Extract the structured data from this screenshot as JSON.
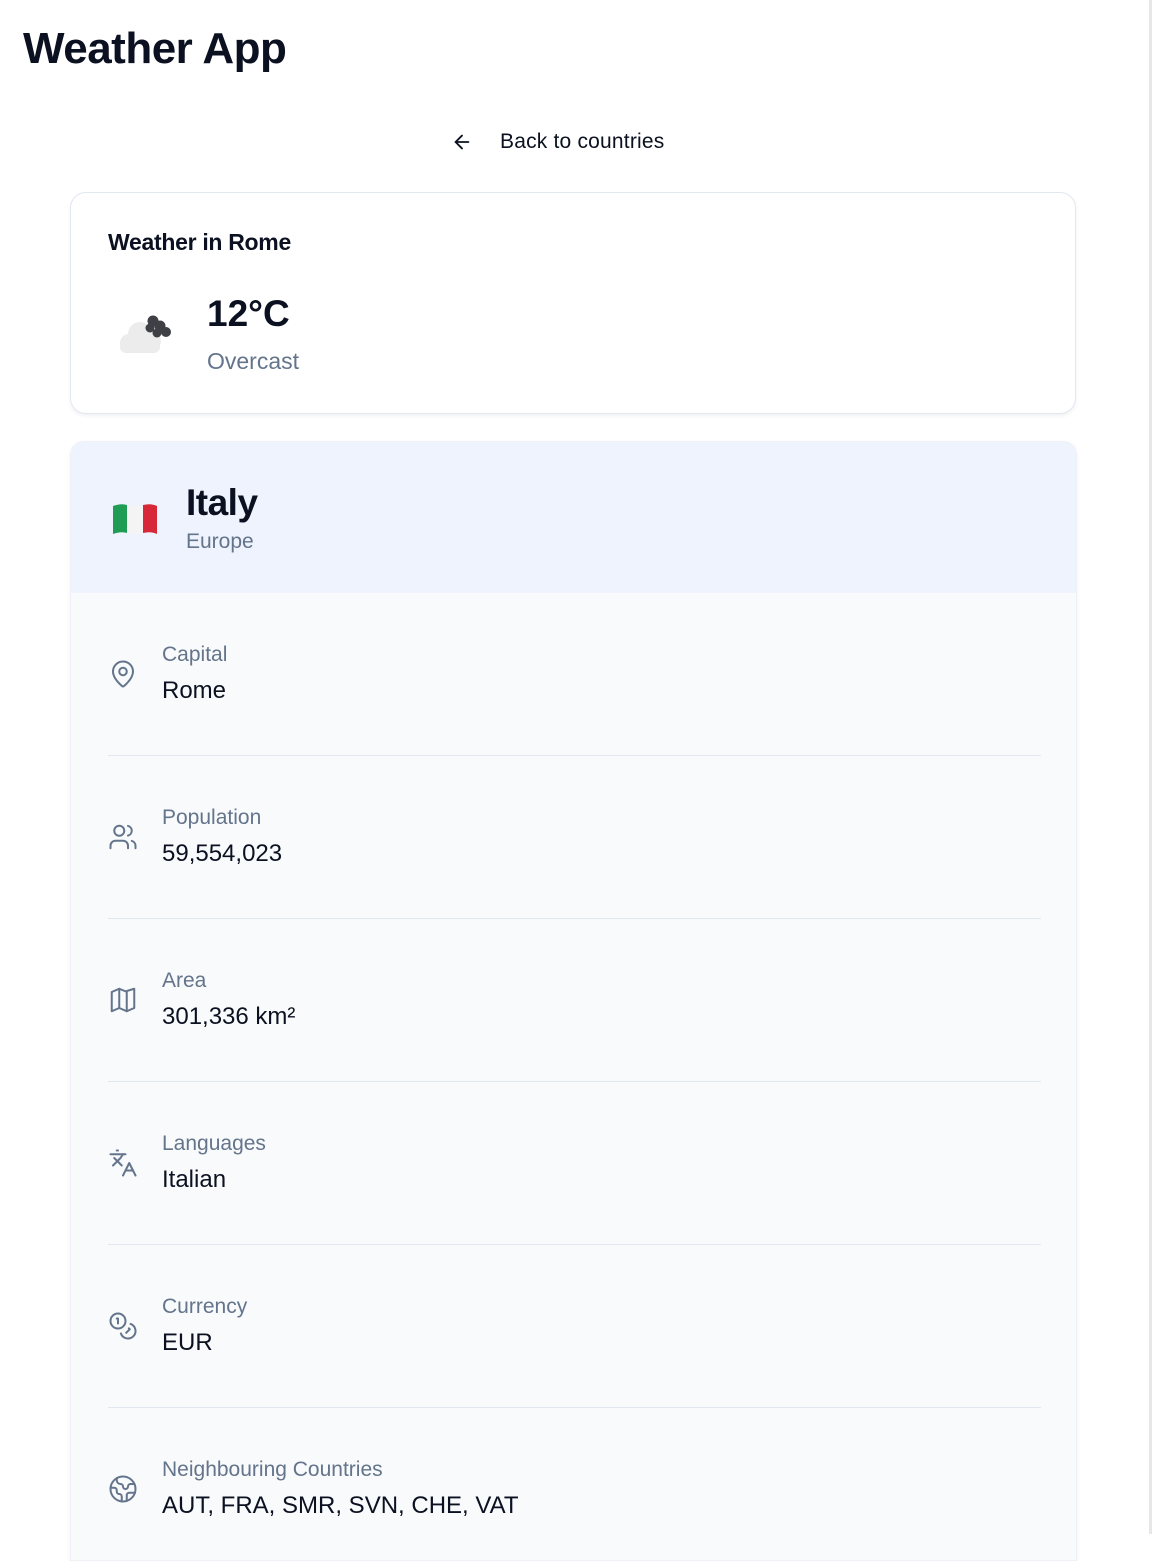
{
  "app": {
    "title": "Weather App"
  },
  "nav": {
    "back_label": "Back to countries",
    "back_icon": "arrow-left-icon"
  },
  "weather": {
    "title": "Weather in Rome",
    "temperature": "12°C",
    "description": "Overcast",
    "icon": "cloud-icon"
  },
  "country": {
    "name": "Italy",
    "region": "Europe",
    "flag_icon": "italy-flag-icon"
  },
  "details": [
    {
      "label": "Capital",
      "value": "Rome",
      "icon": "map-pin-icon"
    },
    {
      "label": "Population",
      "value": "59,554,023",
      "icon": "users-icon"
    },
    {
      "label": "Area",
      "value": "301,336 km²",
      "icon": "map-icon"
    },
    {
      "label": "Languages",
      "value": "Italian",
      "icon": "languages-icon"
    },
    {
      "label": "Currency",
      "value": "EUR",
      "icon": "coins-icon"
    },
    {
      "label": "Neighbouring Countries",
      "value": "AUT, FRA, SMR, SVN, CHE, VAT",
      "icon": "globe-icon"
    }
  ],
  "colors": {
    "text_primary": "#0b1120",
    "text_muted": "#64748b",
    "header_bg": "#eef3fd",
    "card_bg": "#f8fafc",
    "border": "#e2e8f0",
    "flag_green": "#1f9d55",
    "flag_red": "#d62839"
  }
}
